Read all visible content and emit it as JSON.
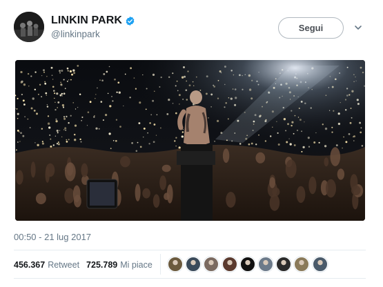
{
  "account": {
    "display_name": "LINKIN PARK",
    "handle": "@linkinpark",
    "verified": true,
    "verified_color": "#1da1f2"
  },
  "actions": {
    "follow_label": "Segui",
    "more_icon": "chevron-down-icon"
  },
  "media": {
    "kind": "photo",
    "description_icon": "concert-photo"
  },
  "tweet": {
    "timestamp": "00:50 - 21 lug 2017"
  },
  "stats": {
    "retweets_count": "456.367",
    "retweets_label": "Retweet",
    "likes_count": "725.789",
    "likes_label": "Mi piace"
  },
  "likers": [
    {
      "avatar": "avatar-1",
      "color": "#6b5a3e"
    },
    {
      "avatar": "avatar-2",
      "color": "#3a4a5a"
    },
    {
      "avatar": "avatar-3",
      "color": "#7a6a60"
    },
    {
      "avatar": "avatar-4",
      "color": "#5a3a2e"
    },
    {
      "avatar": "avatar-5",
      "color": "#111111"
    },
    {
      "avatar": "avatar-6",
      "color": "#6c7a8a"
    },
    {
      "avatar": "avatar-7",
      "color": "#2a2a2a"
    },
    {
      "avatar": "avatar-8",
      "color": "#8a7a5a"
    },
    {
      "avatar": "avatar-9",
      "color": "#4a5a6a"
    }
  ]
}
